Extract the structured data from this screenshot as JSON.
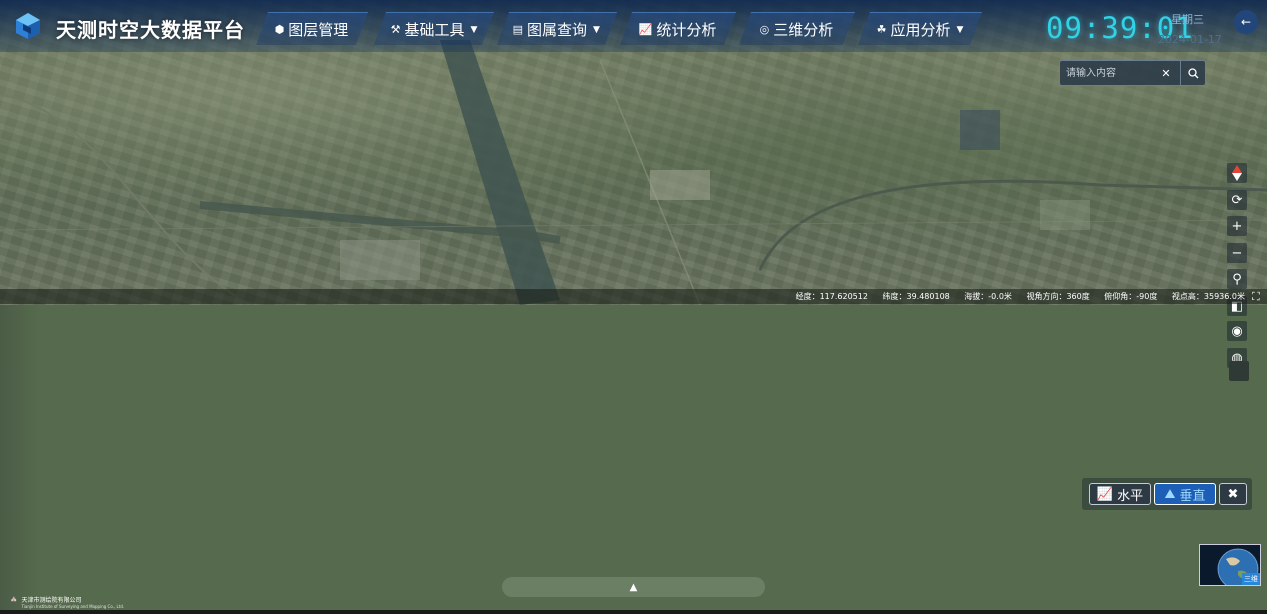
{
  "app": {
    "title": "天测时空大数据平台"
  },
  "nav": [
    {
      "label": "图层管理",
      "icon": "layers-icon",
      "dropdown": false
    },
    {
      "label": "基础工具",
      "icon": "tools-icon",
      "dropdown": true
    },
    {
      "label": "图属查询",
      "icon": "query-icon",
      "dropdown": true
    },
    {
      "label": "统计分析",
      "icon": "chart-icon",
      "dropdown": false
    },
    {
      "label": "三维分析",
      "icon": "3d-icon",
      "dropdown": false
    },
    {
      "label": "应用分析",
      "icon": "apps-icon",
      "dropdown": true
    }
  ],
  "clock": {
    "time": "09:39:01",
    "weekday": "星期三",
    "date": "2024-01-17"
  },
  "search": {
    "placeholder": "请输入内容",
    "value": ""
  },
  "toolbar": [
    "compass-icon",
    "refresh-icon",
    "zoom-in-icon",
    "zoom-out-icon",
    "locate-user-icon",
    "split-view-icon",
    "eye-icon",
    "globe-icon"
  ],
  "status": {
    "longitude": "经度：117.620512",
    "latitude": "纬度：39.480108",
    "altitude": "海拔：-0.0米",
    "heading": "视角方向：360度",
    "pitch": "俯仰角：-90度",
    "height": "视点高：35936.0米"
  },
  "section_panel": {
    "horizontal": "水平",
    "vertical": "垂直",
    "active": "vertical"
  },
  "thumbnail": {
    "label": "三维"
  },
  "footer": {
    "company": "天津市测绘院有限公司",
    "company_en": "Tianjin Institute of Surveying and Mapping Co., Ltd."
  },
  "colors": {
    "accent": "#31d1e6",
    "terrain": "#566b4d",
    "nav_bg": "#0e2850",
    "active_btn": "#1d5fb6"
  }
}
